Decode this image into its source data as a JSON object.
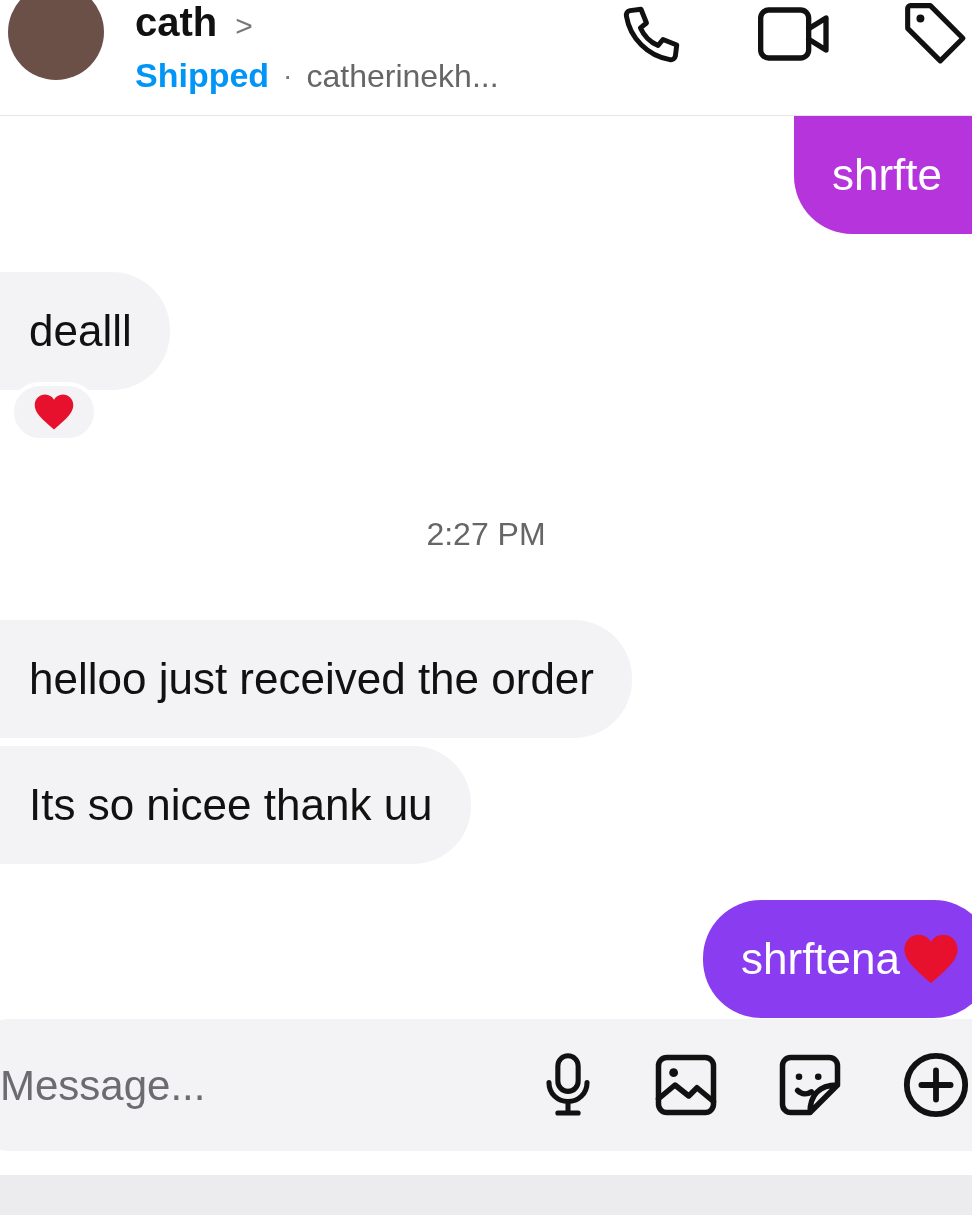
{
  "header": {
    "name": "cath",
    "chevron": ">",
    "status": "Shipped",
    "separator": "·",
    "username": "catherinekh..."
  },
  "messages": [
    {
      "kind": "sent",
      "text": "shrfte",
      "trailing_heart": false,
      "color": "#b534dc"
    },
    {
      "kind": "received",
      "text": "dealll",
      "reacted": true
    },
    {
      "kind": "timestamp",
      "text": "2:27 PM"
    },
    {
      "kind": "received",
      "text": "helloo just received the order",
      "reacted": false
    },
    {
      "kind": "received",
      "text": "Its so nicee thank uu",
      "reacted": false
    },
    {
      "kind": "sent",
      "text": "shrftena",
      "trailing_heart": true,
      "color": "#8a3df0"
    }
  ],
  "composer": {
    "placeholder": "Message..."
  }
}
